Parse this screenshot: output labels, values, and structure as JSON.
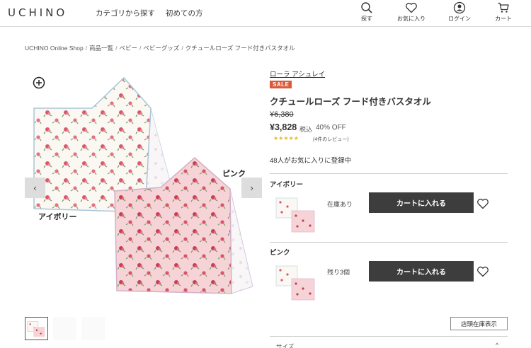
{
  "header": {
    "logo": "UCHINO",
    "nav_category": "カテゴリから探す",
    "nav_first": "初めての方",
    "search_label": "探す",
    "fav_label": "お気に入り",
    "login_label": "ログイン",
    "cart_label": "カート"
  },
  "breadcrumb": [
    "UCHINO Online Shop",
    "商品一覧",
    "ベビー",
    "ベビーグッズ",
    "クチュールローズ フード付きバスタオル"
  ],
  "gallery": {
    "label_ivory": "アイボリー",
    "label_pink": "ピンク",
    "prev_icon": "‹",
    "next_icon": "›"
  },
  "product": {
    "brand": "ローラ アシュレイ",
    "badge": "SALE",
    "title": "クチュールローズ フード付きバスタオル",
    "old_price": "¥6,380",
    "price": "¥3,828",
    "tax": "税込",
    "discount": "40% OFF",
    "stars": "★★★★★",
    "reviews": "(4件のレビュー)",
    "fav_count": "48人がお気に入りに登録中"
  },
  "variants": [
    {
      "name": "アイボリー",
      "stock": "在庫あり",
      "cart_label": "カートに入れる"
    },
    {
      "name": "ピンク",
      "stock": "残り3個",
      "cart_label": "カートに入れる"
    }
  ],
  "store_stock_label": "店頭在庫表示",
  "size_label": "サイズ",
  "size_chevron": "^",
  "colors": {
    "sale_badge": "#d95b3b",
    "cart_button": "#3d3d3d",
    "stars": "#e8b929",
    "towel_pink": "#f6d3d6",
    "towel_ivory": "#fbf7f2"
  }
}
